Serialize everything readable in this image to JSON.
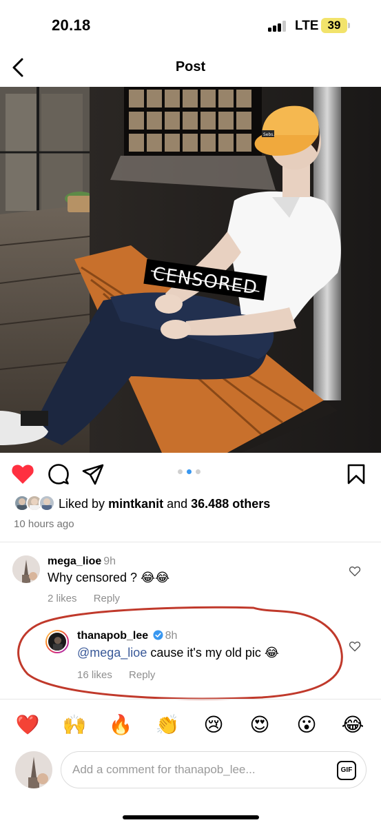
{
  "status_bar": {
    "time": "20.18",
    "network": "LTE",
    "battery": "39"
  },
  "header": {
    "title": "Post"
  },
  "photo": {
    "overlay_text": "CENSORED",
    "cap_text": "Sebs."
  },
  "post": {
    "liked_by_prefix": "Liked by",
    "liked_by_user": "mintkanit",
    "liked_by_and": "and",
    "liked_by_others": "36.488 others",
    "time_ago": "10 hours ago",
    "carousel": {
      "count": 3,
      "active_index": 1
    }
  },
  "comments": [
    {
      "username": "mega_lioe",
      "age": "9h",
      "text": "Why censored ? 😂😂",
      "likes": "2 likes",
      "reply_label": "Reply"
    },
    {
      "username": "thanapob_lee",
      "age": "8h",
      "mention": "@mega_lioe",
      "text": "cause it's my old pic 😂",
      "likes": "16 likes",
      "reply_label": "Reply",
      "verified": true
    }
  ],
  "reactions": [
    "❤️",
    "🙌",
    "🔥",
    "👏",
    "😢",
    "😍",
    "😮",
    "😂"
  ],
  "composer": {
    "placeholder": "Add a comment for thanapob_lee...",
    "gif_label": "GIF"
  },
  "colors": {
    "like_red": "#ff3040",
    "link_blue": "#385898",
    "verified_blue": "#3897f0",
    "annotation_red": "#c0392b"
  }
}
